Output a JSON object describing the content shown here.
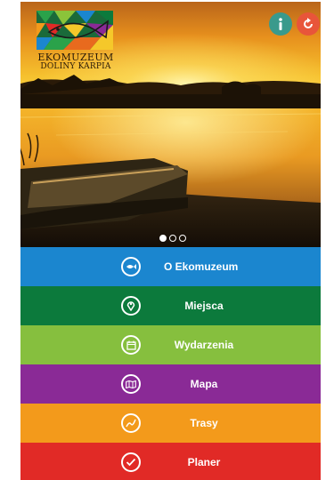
{
  "logo": {
    "line1": "EKOMUZEUM",
    "line2": "DOLINY KARPIA"
  },
  "header": {
    "info_icon": "info-icon",
    "sync_icon": "refresh-icon",
    "info_color": "#3a9a8c",
    "sync_color": "#e8553a"
  },
  "carousel": {
    "slides": 3,
    "active": 0
  },
  "menu": {
    "items": [
      {
        "label": "O Ekomuzeum",
        "icon": "fish-icon",
        "color": "#1b86cf"
      },
      {
        "label": "Miejsca",
        "icon": "map-pin-icon",
        "color": "#0c7a3c"
      },
      {
        "label": "Wydarzenia",
        "icon": "calendar-icon",
        "color": "#86bf3e"
      },
      {
        "label": "Mapa",
        "icon": "map-icon",
        "color": "#8a2a96"
      },
      {
        "label": "Trasy",
        "icon": "route-icon",
        "color": "#f39a1b"
      },
      {
        "label": "Planer",
        "icon": "checkmark-icon",
        "color": "#e12a26"
      }
    ]
  }
}
